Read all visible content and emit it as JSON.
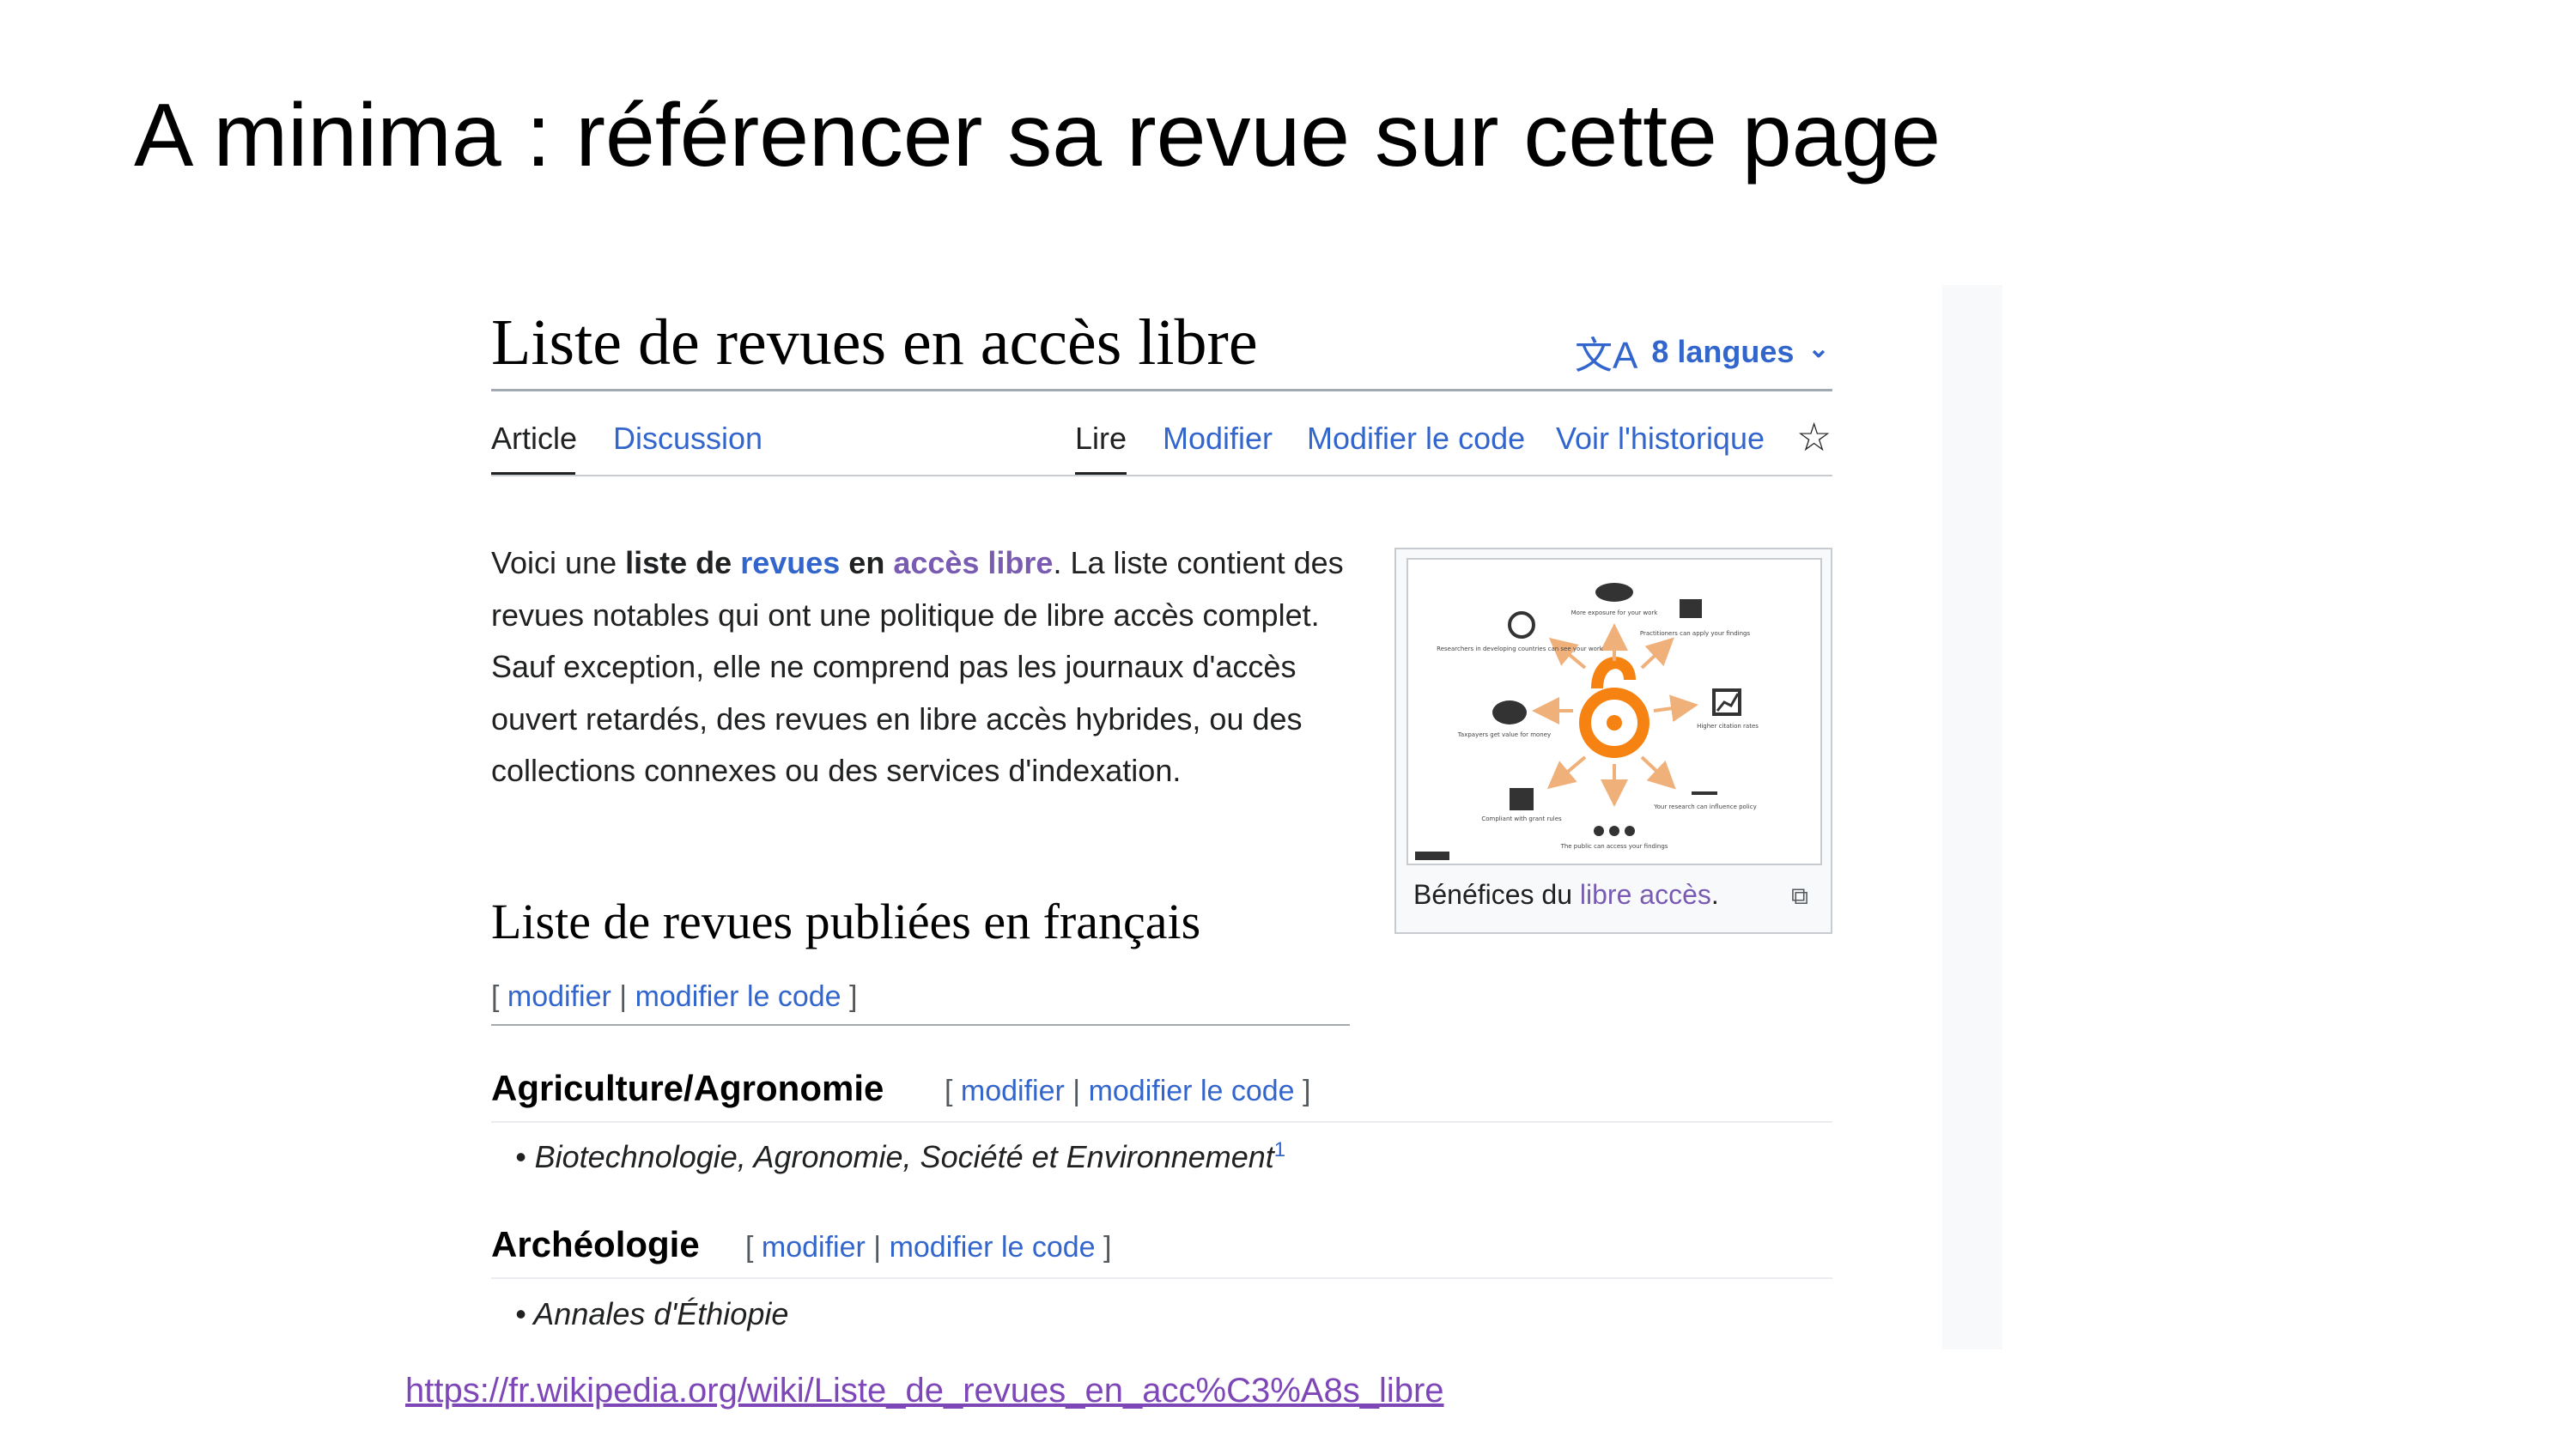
{
  "slide": {
    "title": "A minima : référencer sa revue sur cette page",
    "url": "https://fr.wikipedia.org/wiki/Liste_de_revues_en_acc%C3%A8s_libre"
  },
  "page": {
    "heading": "Liste de revues en accès libre",
    "languages_label": "8 langues"
  },
  "tabs": {
    "left": [
      "Article",
      "Discussion"
    ],
    "right": [
      "Lire",
      "Modifier",
      "Modifier le code",
      "Voir l'historique"
    ]
  },
  "intro": {
    "p1_a": "Voici une ",
    "p1_b": "liste de",
    "p1_c": " ",
    "p1_d": "revues",
    "p1_e": " en ",
    "p1_f": "accès libre",
    "p1_g": ". La liste contient des revues notables qui ont une politique de libre accès complet. Sauf exception, elle ne comprend pas les journaux d'accès ouvert retardés, des revues en libre accès hybrides, ou des collections connexes ou des services d'indexation."
  },
  "figure": {
    "caption_prefix": "Bénéfices du ",
    "caption_link": "libre accès",
    "caption_suffix": ".",
    "labels": {
      "top": "More exposure for your work",
      "top_right": "Practitioners can apply your findings",
      "right": "Higher citation rates",
      "bottom_right": "Your research can influence policy",
      "bottom": "The public can access your findings",
      "bottom_left": "Compliant with grant rules",
      "left": "Taxpayers get value for money",
      "top_left": "Researchers in developing countries can see your work"
    }
  },
  "section": {
    "title": "Liste de revues publiées en français",
    "edit_open": "[ ",
    "edit_link1": "modifier",
    "edit_sep": " | ",
    "edit_link2": "modifier le code",
    "edit_close": " ]"
  },
  "subsections": [
    {
      "title": "Agriculture/Agronomie",
      "item": "Biotechnologie, Agronomie, Société et Environnement",
      "ref": "1"
    },
    {
      "title": "Archéologie",
      "item": "Annales d'Éthiopie"
    }
  ]
}
